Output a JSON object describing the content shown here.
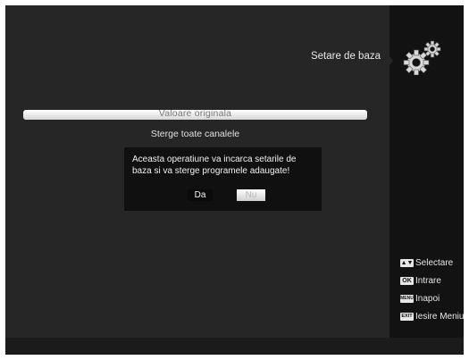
{
  "header": {
    "title": "Setare de baza",
    "icon": "gear-icon"
  },
  "menu": {
    "items": [
      {
        "label": "Valoare originala",
        "selected": true
      },
      {
        "label": "Sterge toate canalele",
        "selected": false
      }
    ]
  },
  "dialog": {
    "message": "Aceasta operatiune va incarca setarile de baza si va sterge programele adaugate!",
    "yes_label": "Da",
    "no_label": "Nu",
    "focused": "Nu"
  },
  "help": {
    "items": [
      {
        "key": "▲▼",
        "key_icon": "updown-key-icon",
        "label": "Selectare"
      },
      {
        "key": "OK",
        "key_icon": "ok-key-icon",
        "label": "Intrare"
      },
      {
        "key": "MENU",
        "key_icon": "menu-key-icon",
        "label": "Inapoi"
      },
      {
        "key": "EXIT",
        "key_icon": "exit-key-icon",
        "label": "Iesire Meniu"
      }
    ]
  },
  "colors": {
    "background": "#262626",
    "side_panel": "#121212",
    "dialog": "#101010",
    "highlight": "#ffffff"
  }
}
